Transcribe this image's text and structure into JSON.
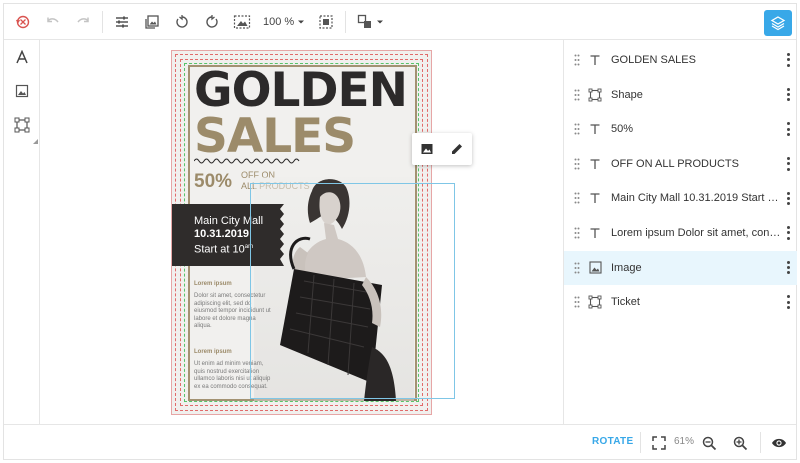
{
  "toolbar": {
    "zoom_label": "100 %",
    "items": [
      "history-icon",
      "undo-icon",
      "redo-icon",
      "adjust-icon",
      "image-replace-icon",
      "rotate-left-icon",
      "rotate-right-icon",
      "fit-image-icon",
      "zoom-select",
      "crop-icon",
      "arrange-icon",
      "layers-icon"
    ]
  },
  "left_tools": [
    "text-tool-icon",
    "image-tool-icon",
    "shape-tool-icon"
  ],
  "poster": {
    "title_line1": "GOLDEN",
    "title_line2": "SALES",
    "discount": "50%",
    "off_line1": "OFF ON",
    "off_line2": "ALL PRODUCTS",
    "ticket_line1": "Main City Mall",
    "ticket_line2": "10.31.2019",
    "ticket_line3_base": "Start at 10",
    "ticket_line3_sup": "am",
    "lorem1_heading": "Lorem ipsum",
    "lorem1_text": "Dolor sit amet, consectetur adipiscing elit, sed do eiusmod tempor incididunt ut labore et dolore magna aliqua.",
    "lorem2_heading": "Lorem ipsum",
    "lorem2_text": "Ut enim ad minim veniam, quis nostrud exercitation ullamco laboris nisi ut aliquip ex ea commodo consequat."
  },
  "layers": [
    {
      "icon": "text",
      "label": "GOLDEN SALES",
      "active": false
    },
    {
      "icon": "shape",
      "label": "Shape",
      "active": false
    },
    {
      "icon": "text",
      "label": "50%",
      "active": false
    },
    {
      "icon": "text",
      "label": "OFF ON ALL PRODUCTS",
      "active": false
    },
    {
      "icon": "text",
      "label": "Main City Mall 10.31.2019 Start at 10...",
      "active": false
    },
    {
      "icon": "text",
      "label": "Lorem ipsum Dolor sit amet, consecte...",
      "active": false
    },
    {
      "icon": "image",
      "label": "Image",
      "active": true
    },
    {
      "icon": "shape",
      "label": "Ticket",
      "active": false
    }
  ],
  "bottombar": {
    "rotate_label": "ROTATE",
    "zoom_value": "61%"
  },
  "colors": {
    "accent": "#38a8e8",
    "active_row": "#e8f6fd",
    "poster_dark": "#2c2a2a",
    "poster_gold": "#9c8b6a"
  }
}
